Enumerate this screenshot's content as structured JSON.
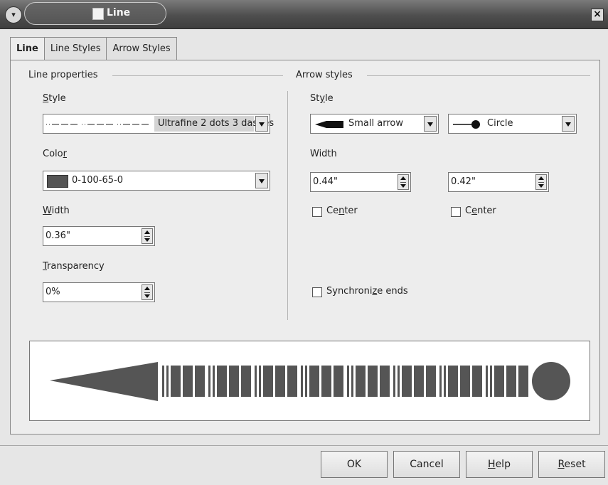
{
  "window": {
    "title": "Line",
    "close_glyph": "×",
    "menu_glyph": "▾"
  },
  "tabs": [
    {
      "label": "Line",
      "active": true
    },
    {
      "label": "Line Styles",
      "active": false
    },
    {
      "label": "Arrow Styles",
      "active": false
    }
  ],
  "line_properties": {
    "group_title": "Line properties",
    "style": {
      "label_mn": "S",
      "label_rest": "tyle",
      "value": "Ultrafine 2 dots 3 dashes"
    },
    "color": {
      "label_pre": "Colo",
      "label_mn": "r",
      "value": "0-100-65-0",
      "swatch": "#555555"
    },
    "width": {
      "label_mn": "W",
      "label_rest": "idth",
      "value": "0.36\""
    },
    "transparency": {
      "label_mn": "T",
      "label_rest": "ransparency",
      "value": "0%"
    }
  },
  "arrow_styles": {
    "group_title": "Arrow styles",
    "style_label_pre": "St",
    "style_label_mn": "y",
    "style_label_post": "le",
    "start_style": "Small arrow",
    "end_style": "Circle",
    "width_label": "Width",
    "start_width": "0.44\"",
    "end_width": "0.42\"",
    "center_pre": "Ce",
    "center_mn": "n",
    "center_post": "ter",
    "center2_pre": "C",
    "center2_mn": "e",
    "center2_post": "nter",
    "sync_pre": "Synchroni",
    "sync_mn": "z",
    "sync_post": "e ends"
  },
  "buttons": {
    "ok": "OK",
    "cancel": "Cancel",
    "help_mn": "H",
    "help_rest": "elp",
    "reset_mn": "R",
    "reset_rest": "eset"
  },
  "colors": {
    "line": "#555555",
    "preview_bg": "#ffffff"
  }
}
